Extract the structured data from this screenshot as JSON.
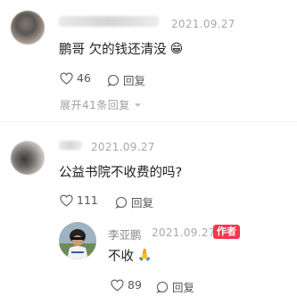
{
  "comments": [
    {
      "date": "2021.09.27",
      "text": "鹏哥 欠的钱还清没",
      "emoji": "😁",
      "likes": "46",
      "reply_label": "回复",
      "expand_label": "展开41条回复"
    },
    {
      "date": "2021.09.27",
      "text": "公益书院不收费的吗?",
      "likes": "111",
      "reply_label": "回复",
      "reply": {
        "author": "李亚鹏",
        "date": "2021.09.27",
        "badge": "作者",
        "text": "不收",
        "emoji": "🙏",
        "likes": "89",
        "reply_label": "回复"
      }
    }
  ],
  "colors": {
    "badge": "#f3384e",
    "meta_text": "#a9a9a9"
  },
  "icons": [
    "heart-icon",
    "comment-icon",
    "chevron-down-icon"
  ]
}
